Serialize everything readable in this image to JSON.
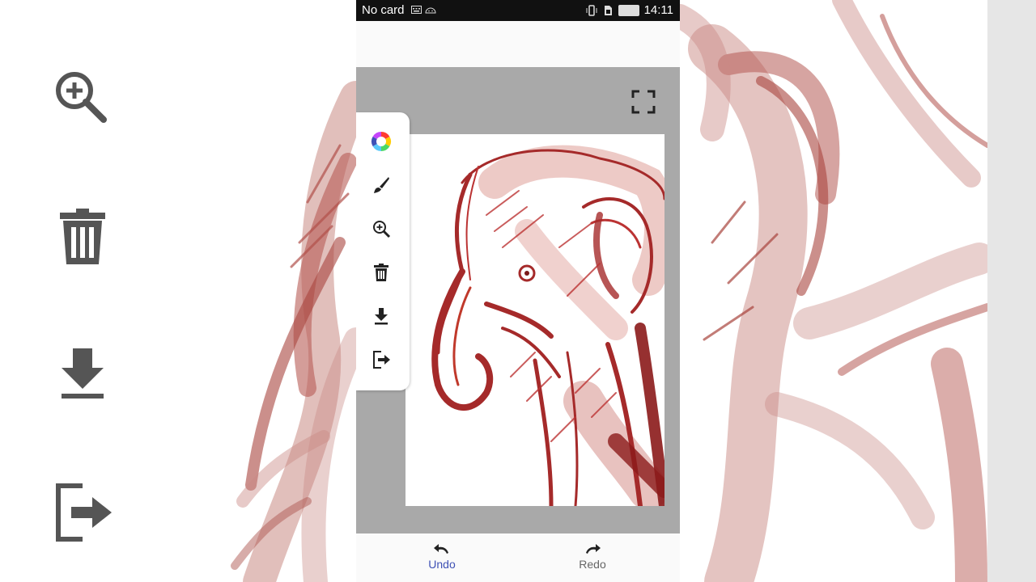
{
  "status_bar": {
    "carrier": "No card",
    "time": "14:11"
  },
  "bottom_bar": {
    "undo_label": "Undo",
    "redo_label": "Redo"
  },
  "colors": {
    "accent": "#3f51b5",
    "sketch": "#a52a2a",
    "canvas_bg": "#a9a9a9",
    "status_bar": "#111111"
  },
  "icons": {
    "side_panel": [
      "zoom-in-icon",
      "trash-icon",
      "download-icon",
      "exit-icon"
    ],
    "toolbar": [
      "color-wheel-icon",
      "brush-icon",
      "zoom-icon",
      "trash-icon",
      "download-icon",
      "exit-icon"
    ],
    "canvas": [
      "fullscreen-icon"
    ]
  }
}
